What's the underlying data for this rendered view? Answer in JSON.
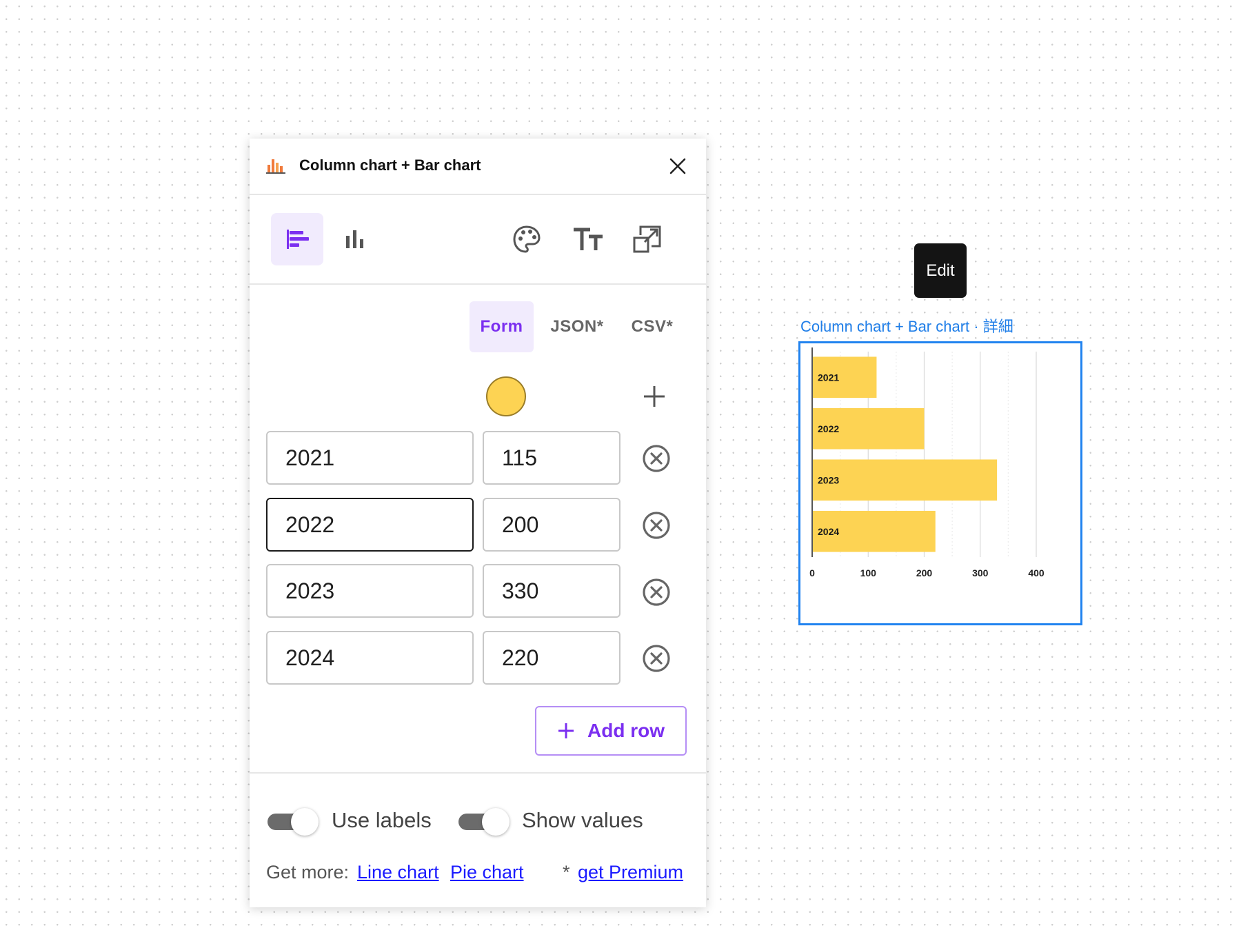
{
  "panel": {
    "title": "Column chart + Bar chart",
    "icons": {
      "header": "bar-chart-color-icon",
      "close": "close-icon"
    },
    "toolbar": {
      "buttons": [
        {
          "icon": "horizontal-bar-chart-icon",
          "active": true
        },
        {
          "icon": "column-chart-icon",
          "active": false
        },
        {
          "icon": "palette-icon",
          "active": false
        },
        {
          "icon": "text-size-icon",
          "active": false
        },
        {
          "icon": "open-external-icon",
          "active": false
        }
      ]
    },
    "tabs": [
      {
        "label": "Form",
        "active": true
      },
      {
        "label": "JSON*",
        "active": false
      },
      {
        "label": "CSV*",
        "active": false
      }
    ],
    "series_color": "#fdd353",
    "rows": [
      {
        "label": "2021",
        "value": "115"
      },
      {
        "label": "2022",
        "value": "200"
      },
      {
        "label": "2023",
        "value": "330"
      },
      {
        "label": "2024",
        "value": "220"
      }
    ],
    "add_row_label": "Add row",
    "toggles": [
      {
        "label": "Use labels",
        "on": true
      },
      {
        "label": "Show values",
        "on": true
      }
    ],
    "footer": {
      "get_more": "Get more:",
      "line_chart": "Line chart",
      "pie_chart": "Pie chart",
      "asterisk": "*",
      "premium": "get Premium"
    }
  },
  "tooltip": {
    "label": "Edit"
  },
  "canvas_chart": {
    "caption": "Column chart + Bar chart",
    "caption_suffix": "· 詳細",
    "selection_color": "#2183ef"
  },
  "chart_data": {
    "type": "bar",
    "orientation": "horizontal",
    "categories": [
      "2021",
      "2022",
      "2023",
      "2024"
    ],
    "values": [
      115,
      200,
      330,
      220
    ],
    "xlim": [
      0,
      400
    ],
    "xticks": [
      "0",
      "100",
      "200",
      "300",
      "400"
    ],
    "bar_color": "#fdd353",
    "grid": true,
    "title": "",
    "xlabel": "",
    "ylabel": ""
  }
}
